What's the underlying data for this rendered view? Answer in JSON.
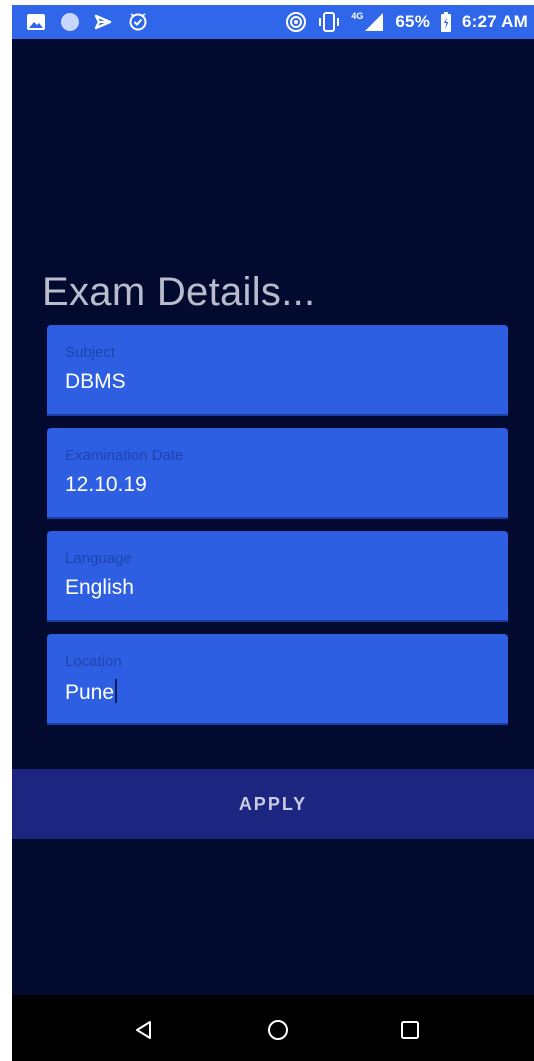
{
  "status_bar": {
    "battery_percent": "65%",
    "time": "6:27 AM",
    "network": "4G",
    "left_icons": [
      "gallery-icon",
      "circle-icon",
      "video-icon",
      "check-circle-icon"
    ],
    "right_icons": [
      "hotspot-icon",
      "vibrate-icon",
      "signal-icon",
      "battery-icon"
    ]
  },
  "page": {
    "title": "Exam Details..."
  },
  "fields": [
    {
      "label": "Subject",
      "value": "DBMS"
    },
    {
      "label": "Examination Date",
      "value": "12.10.19"
    },
    {
      "label": "Language",
      "value": "English"
    },
    {
      "label": "Location",
      "value": "Pune"
    }
  ],
  "apply_button": {
    "label": "APPLY"
  },
  "nav": {
    "icons": [
      "back-icon",
      "home-icon",
      "recent-apps-icon"
    ]
  },
  "colors": {
    "status_bar": "#2f66ea",
    "background": "#030a30",
    "field_bg": "#2e5fe3",
    "button_bg": "#1c2580",
    "title_text": "#b8bccb"
  }
}
